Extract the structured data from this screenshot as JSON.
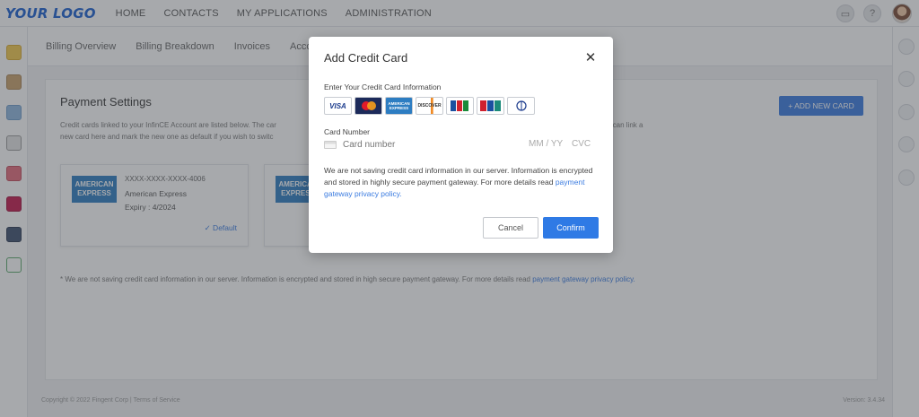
{
  "topbar": {
    "logo": "YOUR LOGO",
    "nav": [
      "HOME",
      "CONTACTS",
      "MY APPLICATIONS",
      "ADMINISTRATION"
    ],
    "help_icon": "?"
  },
  "subtabs": [
    "Billing Overview",
    "Billing Breakdown",
    "Invoices",
    "Acco"
  ],
  "panel": {
    "title": "Payment Settings",
    "description": "Credit cards linked to your InfinCE Account are listed below. The car",
    "description_cont": "f any. You can link a",
    "description_line2": "new card here and mark the new one as default if you wish to switc",
    "add_button": "+ ADD NEW CARD",
    "cards": [
      {
        "logo": "AMERICAN EXPRESS",
        "number": "XXXX-XXXX-XXXX-4006",
        "brand": "American Express",
        "expiry": "Expiry : 4/2024",
        "default": "✓ Default"
      },
      {
        "logo": "AMERICAN EXPRESS"
      }
    ],
    "footnote": "* We are not saving credit card information in our server. Information is encrypted and stored in high secure payment gateway. For more details read",
    "footnote_link": "payment gateway privacy policy."
  },
  "footer": {
    "left": "Copyright © 2022 Fingent Corp | Terms of Service",
    "right": "Version: 3.4.34"
  },
  "modal": {
    "title": "Add Credit Card",
    "close": "✕",
    "subtitle": "Enter Your Credit Card Information",
    "brands": [
      "VISA",
      "MasterCard",
      "AMERICAN EXPRESS",
      "DISCOVER",
      "JCB",
      "UnionPay",
      "Diners Club"
    ],
    "card_number_label": "Card Number",
    "card_number_placeholder": "Card number",
    "exp_placeholder": "MM / YY",
    "cvc_placeholder": "CVC",
    "note": "We are not saving credit card information in our server. Information is encrypted and stored in highly secure payment gateway. For more details read",
    "note_link": "payment gateway privacy policy.",
    "cancel": "Cancel",
    "confirm": "Confirm"
  },
  "colors": {
    "accent": "#2f7ae5",
    "logo": "#1a5fd0",
    "overlay": "rgba(60,64,72,0.45)"
  }
}
